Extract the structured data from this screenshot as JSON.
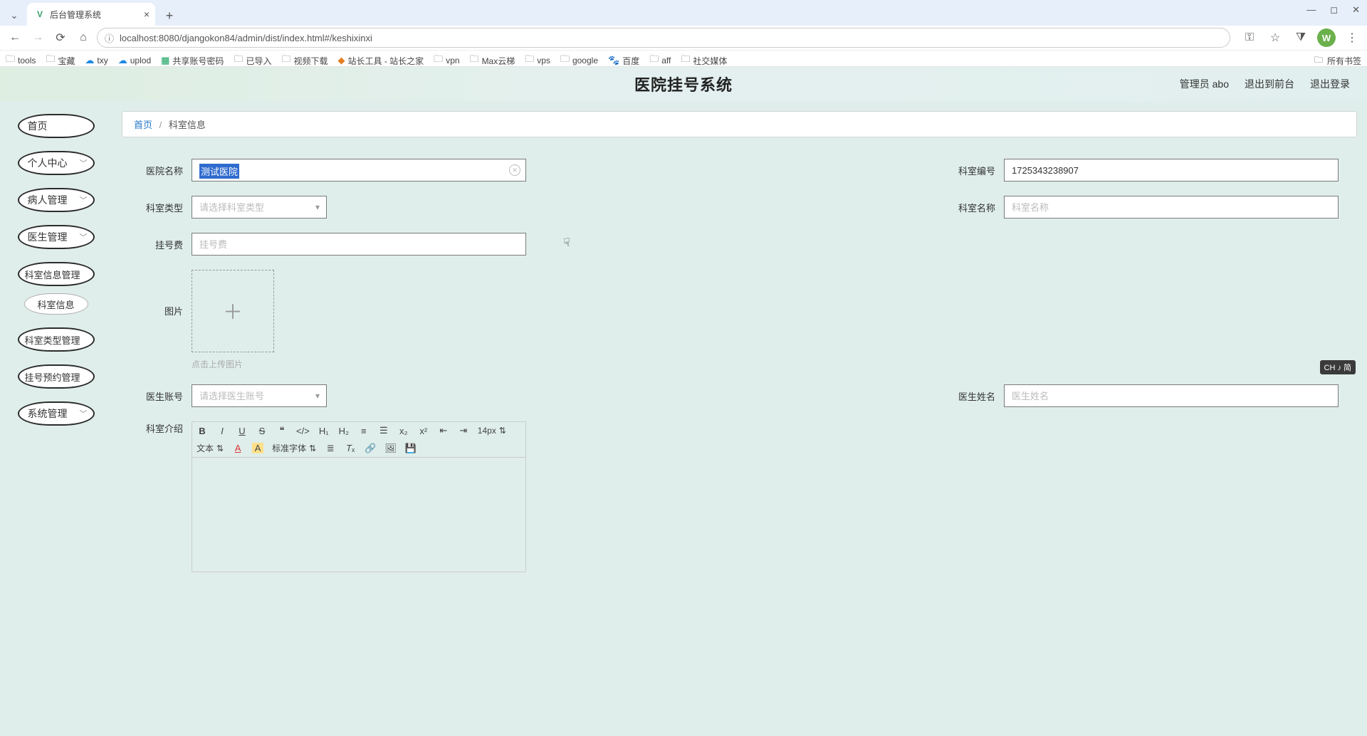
{
  "browser": {
    "tab_title": "后台管理系统",
    "url": "localhost:8080/djangokon84/admin/dist/index.html#/keshixinxi",
    "avatar_letter": "W"
  },
  "bookmarks": [
    "tools",
    "宝藏",
    "txy",
    "uplod",
    "共享账号密码",
    "已导入",
    "视频下载",
    "站长工具 - 站长之家",
    "vpn",
    "Max云梯",
    "vps",
    "google",
    "百度",
    "aff",
    "社交媒体"
  ],
  "bookmarks_right": "所有书签",
  "app": {
    "title": "医院挂号系统",
    "user_label": "管理员 abo",
    "to_front": "退出到前台",
    "logout": "退出登录"
  },
  "sidebar": {
    "items": [
      {
        "label": "首页",
        "chev": false
      },
      {
        "label": "个人中心",
        "chev": true
      },
      {
        "label": "病人管理",
        "chev": true
      },
      {
        "label": "医生管理",
        "chev": true
      },
      {
        "label": "科室信息管理",
        "chev": false
      },
      {
        "label": "科室类型管理",
        "chev": false
      },
      {
        "label": "挂号预约管理",
        "chev": false
      },
      {
        "label": "系统管理",
        "chev": true
      }
    ],
    "sub": "科室信息"
  },
  "breadcrumb": {
    "home": "首页",
    "sep": "/",
    "current": "科室信息"
  },
  "form": {
    "hospital_label": "医院名称",
    "hospital_value": "测试医院",
    "code_label": "科室编号",
    "code_value": "1725343238907",
    "type_label": "科室类型",
    "type_placeholder": "请选择科室类型",
    "dept_name_label": "科室名称",
    "dept_name_placeholder": "科室名称",
    "fee_label": "挂号费",
    "fee_placeholder": "挂号费",
    "img_label": "图片",
    "upload_hint": "点击上传图片",
    "doctor_acct_label": "医生账号",
    "doctor_acct_placeholder": "请选择医生账号",
    "doctor_name_label": "医生姓名",
    "doctor_name_placeholder": "医生姓名",
    "intro_label": "科室介绍"
  },
  "editor": {
    "font_size": "14px",
    "font_type": "文本",
    "font_family": "标准字体"
  },
  "ime": "CH ♪ 简"
}
